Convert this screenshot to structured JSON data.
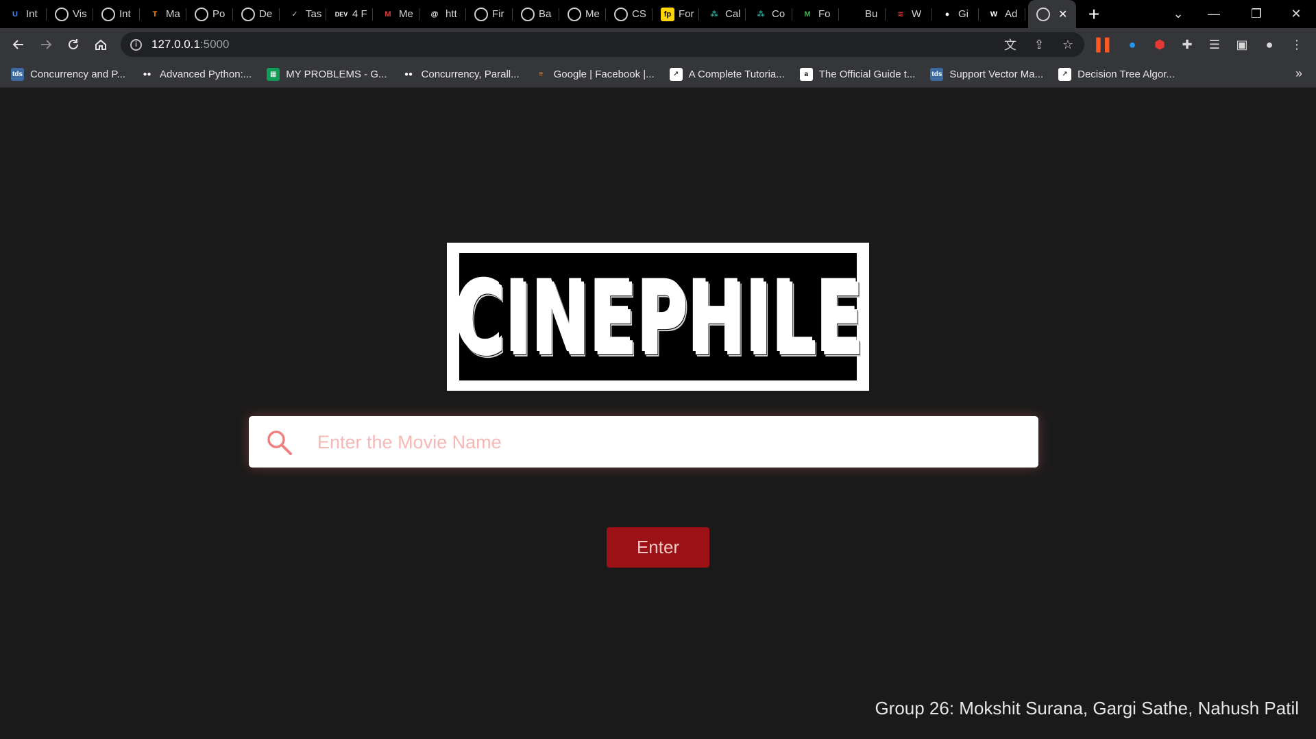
{
  "browser": {
    "tabs": [
      {
        "label": "Int",
        "icon": "u-logo-icon",
        "color": "#3d8bfd"
      },
      {
        "label": "Vis",
        "icon": "globe-icon",
        "color": "#cfcfcf"
      },
      {
        "label": "Int",
        "icon": "globe-icon",
        "color": "#cfcfcf"
      },
      {
        "label": "Ma",
        "icon": "tensorflow-icon",
        "color": "#ff8f00"
      },
      {
        "label": "Po",
        "icon": "globe-icon",
        "color": "#cfcfcf"
      },
      {
        "label": "De",
        "icon": "globe-icon",
        "color": "#cfcfcf"
      },
      {
        "label": "Tas",
        "icon": "checkmark-icon",
        "color": "#cfcfcf"
      },
      {
        "label": "4 F",
        "icon": "dev-icon",
        "color": "#ffffff"
      },
      {
        "label": "Me",
        "icon": "mi-icon",
        "color": "#e53935"
      },
      {
        "label": "htt",
        "icon": "at-icon",
        "color": "#ffffff"
      },
      {
        "label": "Fir",
        "icon": "globe-icon",
        "color": "#cfcfcf"
      },
      {
        "label": "Ba",
        "icon": "globe-icon",
        "color": "#cfcfcf"
      },
      {
        "label": "Me",
        "icon": "globe-icon",
        "color": "#cfcfcf"
      },
      {
        "label": "CS",
        "icon": "globe-icon",
        "color": "#cfcfcf"
      },
      {
        "label": "For",
        "icon": "fp-icon",
        "color": "#ffd500"
      },
      {
        "label": "Cal",
        "icon": "node-icon",
        "color": "#26a69a"
      },
      {
        "label": "Co",
        "icon": "node-icon",
        "color": "#26a69a"
      },
      {
        "label": "Fo",
        "icon": "m-logo-icon",
        "color": "#4caf50"
      },
      {
        "label": "Bu",
        "icon": "blank-icon",
        "color": "#000000"
      },
      {
        "label": "W",
        "icon": "swirl-icon",
        "color": "#e53935"
      },
      {
        "label": "Gi",
        "icon": "github-icon",
        "color": "#ffffff"
      },
      {
        "label": "Ad",
        "icon": "w-icon",
        "color": "#ffffff"
      }
    ],
    "active_tab_icon": "globe-icon",
    "new_tab_label": "+",
    "url_host": "127.0.0.1",
    "url_port": ":5000",
    "bookmarks": [
      {
        "label": "Concurrency and P...",
        "icon": "tds-icon"
      },
      {
        "label": "Advanced Python:...",
        "icon": "medium-icon"
      },
      {
        "label": "MY PROBLEMS - G...",
        "icon": "sheets-icon"
      },
      {
        "label": "Concurrency, Parall...",
        "icon": "medium-icon"
      },
      {
        "label": "Google | Facebook |...",
        "icon": "stackoverflow-icon"
      },
      {
        "label": "A Complete Tutoria...",
        "icon": "chart-icon"
      },
      {
        "label": "The Official Guide t...",
        "icon": "amazon-icon"
      },
      {
        "label": "Support Vector Ma...",
        "icon": "tds-icon"
      },
      {
        "label": "Decision Tree Algor...",
        "icon": "chart-icon"
      }
    ],
    "bookmarks_more": "»"
  },
  "app": {
    "logo_text": "CINEPHILE",
    "search_placeholder": "Enter the Movie Name",
    "search_value": "",
    "enter_label": "Enter",
    "credit": "Group 26: Mokshit Surana, Gargi Sathe, Nahush Patil"
  },
  "colors": {
    "page_bg": "#1b1a1a",
    "button_bg": "#9b1116",
    "placeholder": "#f6b7b5",
    "search_icon": "#f08080"
  }
}
